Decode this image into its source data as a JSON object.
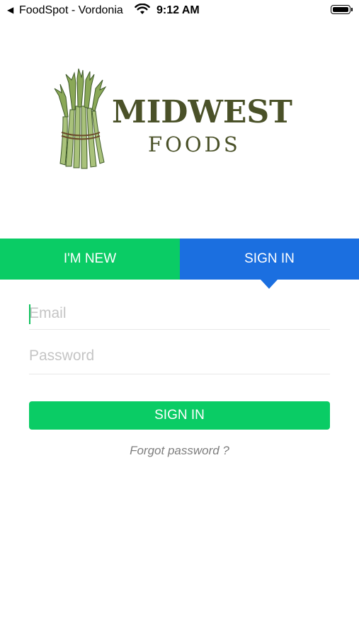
{
  "status_bar": {
    "back_arrow": "◀",
    "carrier": "FoodSpot - Vordonia",
    "time": "9:12 AM",
    "wifi_icon": "wifi-icon",
    "battery_icon": "battery-icon"
  },
  "logo": {
    "word1": "MIDWEST",
    "word2": "FOODS",
    "art_icon": "asparagus-bundle-icon"
  },
  "tabs": {
    "new_label": "I'M NEW",
    "signin_label": "SIGN IN",
    "active": "signin"
  },
  "form": {
    "email_placeholder": "Email",
    "email_value": "",
    "password_placeholder": "Password",
    "password_value": "",
    "submit_label": "SIGN IN",
    "forgot_label": "Forgot password ?"
  },
  "colors": {
    "green": "#0acc65",
    "blue": "#1b6fe0",
    "logo_text": "#4a5128",
    "placeholder": "#c5c5c5"
  }
}
